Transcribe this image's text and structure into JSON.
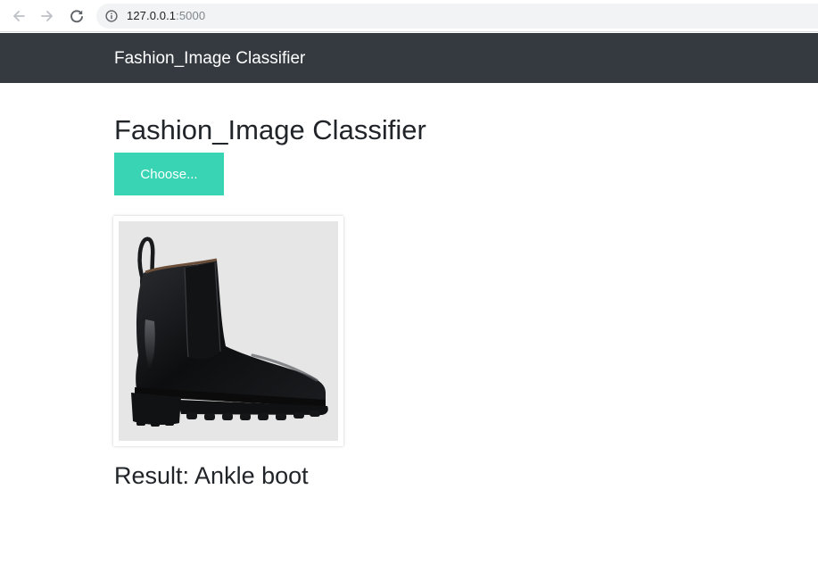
{
  "browser": {
    "url_host": "127.0.0.1",
    "url_port": ":5000"
  },
  "navbar": {
    "brand": "Fashion_Image Classifier"
  },
  "main": {
    "title": "Fashion_Image Classifier",
    "choose_label": "Choose...",
    "result_text": "Result: Ankle boot"
  },
  "colors": {
    "navbar_bg": "#343a40",
    "accent": "#39d4b3",
    "text": "#212529"
  },
  "icons": {
    "back": "arrow-left-icon",
    "forward": "arrow-right-icon",
    "reload": "reload-icon",
    "info": "info-icon",
    "preview": "ankle-boot-image"
  }
}
